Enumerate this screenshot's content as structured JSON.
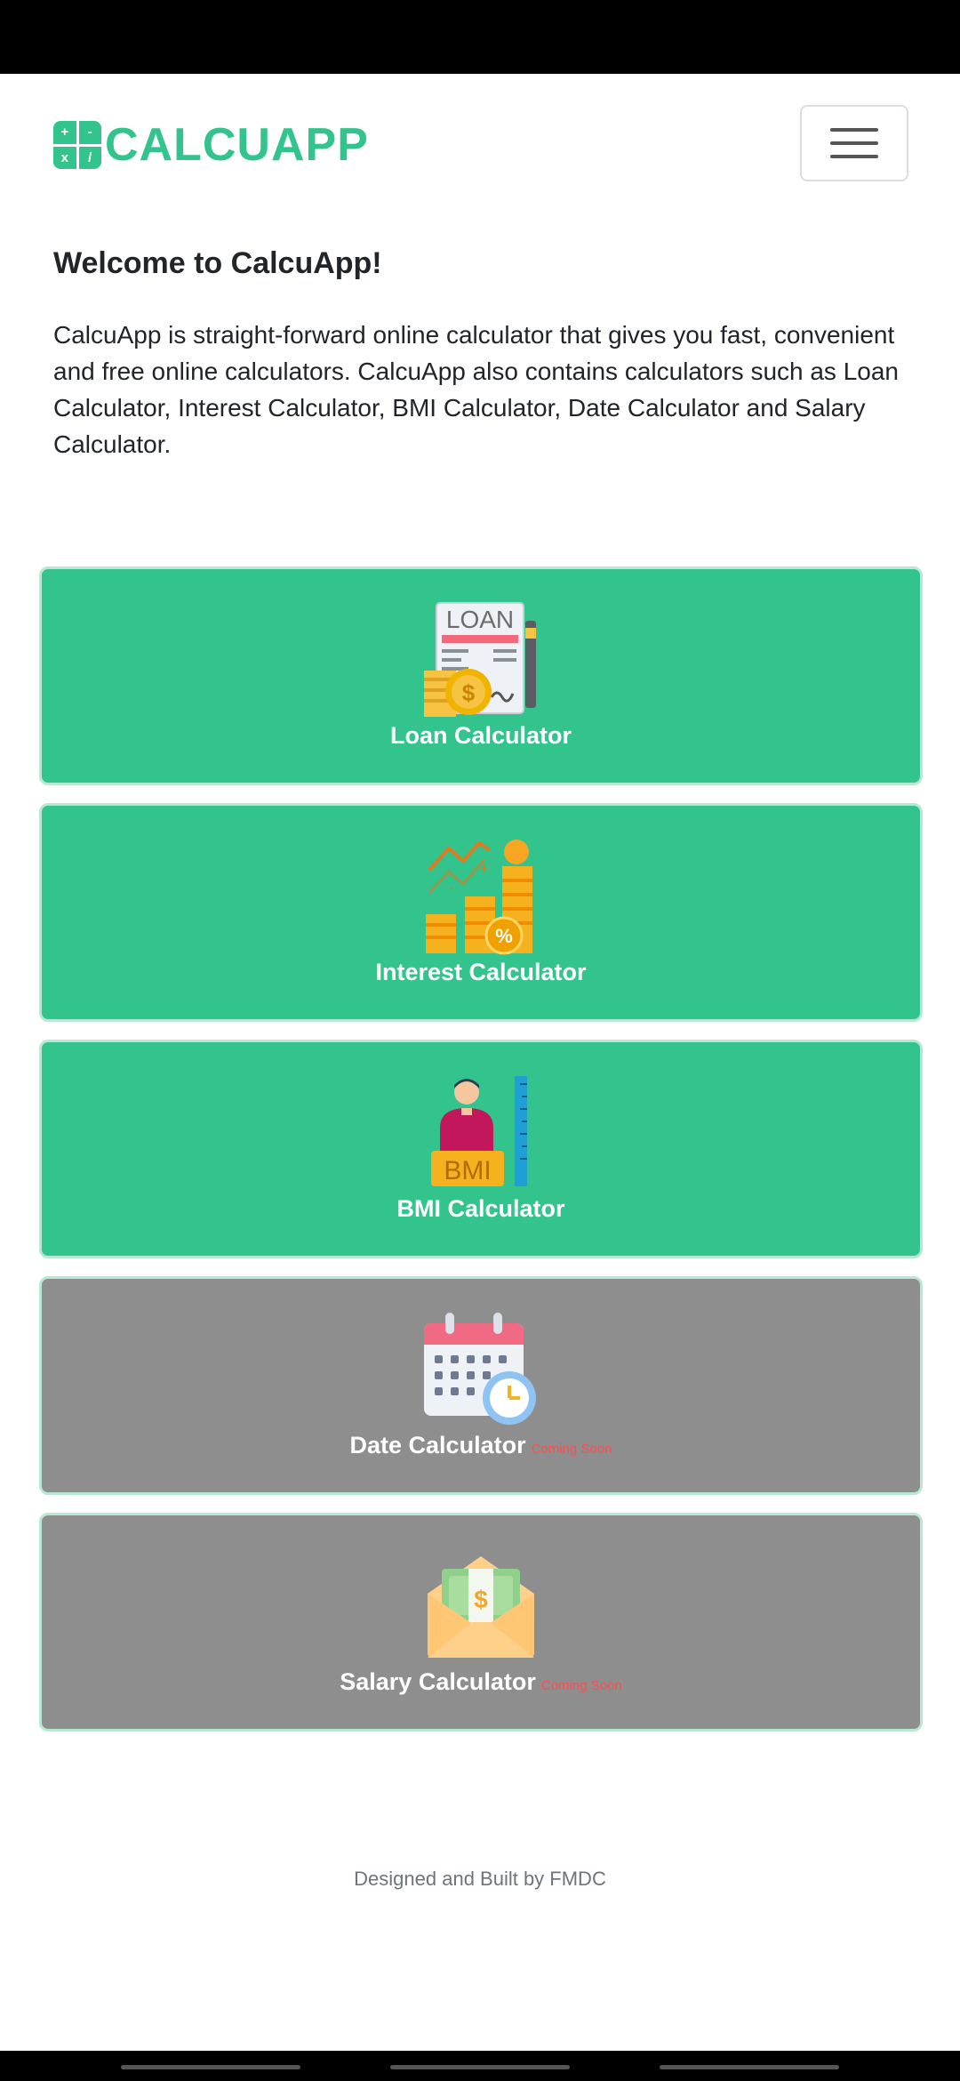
{
  "brand": {
    "logo_symbols": [
      "+",
      "-",
      "x",
      "/"
    ],
    "name": "CALCUAPP",
    "accent_color": "#33c48d"
  },
  "menu": {
    "icon": "hamburger-menu-icon"
  },
  "intro": {
    "title": "Welcome to CalcuApp!",
    "description": "CalcuApp is straight-forward online calculator that gives you fast, convenient and free online calculators. CalcuApp also contains calculators such as Loan Calculator, Interest Calculator, BMI Calculator, Date Calculator and Salary Calculator."
  },
  "calculators": [
    {
      "label": "Loan Calculator",
      "icon": "loan-document-icon",
      "status": ""
    },
    {
      "label": "Interest Calculator",
      "icon": "interest-coins-icon",
      "status": ""
    },
    {
      "label": "BMI Calculator",
      "icon": "bmi-person-icon",
      "status": ""
    },
    {
      "label": "Date Calculator",
      "icon": "calendar-clock-icon",
      "status": "Coming Soon"
    },
    {
      "label": "Salary Calculator",
      "icon": "salary-envelope-icon",
      "status": "Coming Soon"
    }
  ],
  "colors": {
    "active_card": "#33c48d",
    "disabled_card": "#8e8e8e",
    "coming_soon": "#ff4d4f"
  },
  "footer": {
    "text": "Designed and Built by FMDC"
  }
}
